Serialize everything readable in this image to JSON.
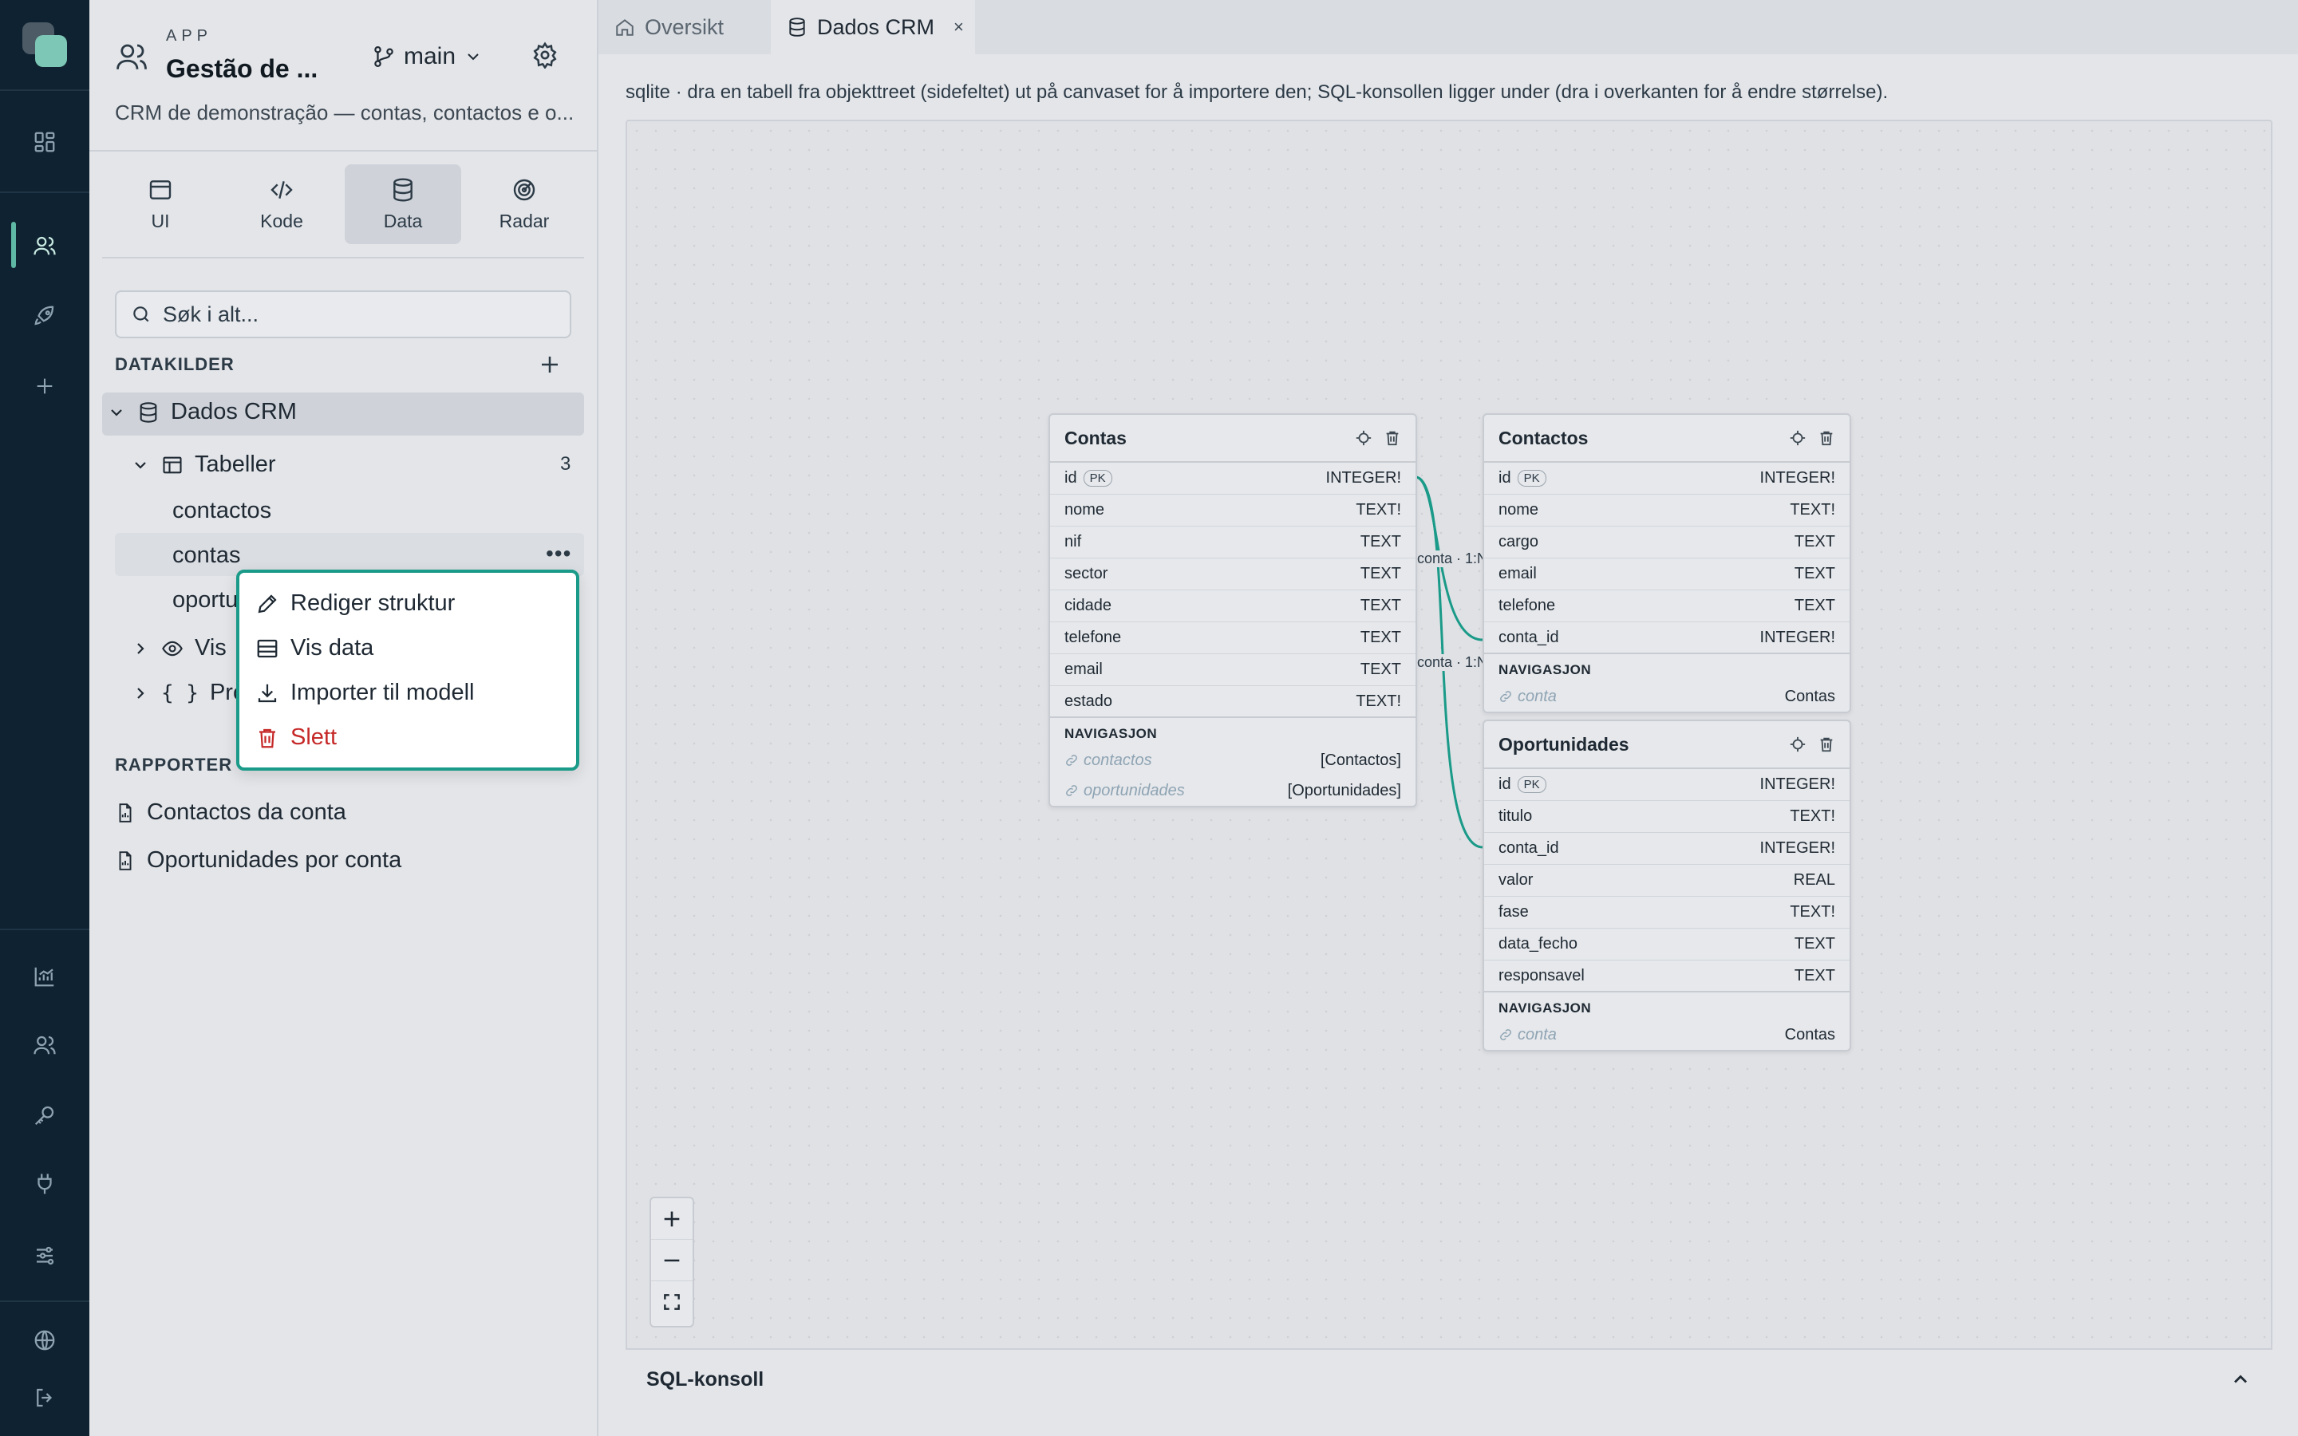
{
  "app": {
    "kicker": "APP",
    "title": "Gestão de ...",
    "branch": "main",
    "description": "CRM de demonstração — contas, contactos e o..."
  },
  "modes": [
    {
      "label": "UI",
      "icon": "window-icon"
    },
    {
      "label": "Kode",
      "icon": "code-icon"
    },
    {
      "label": "Data",
      "icon": "database-icon",
      "active": true
    },
    {
      "label": "Radar",
      "icon": "radar-icon"
    }
  ],
  "search": {
    "placeholder": "Søk i alt..."
  },
  "datasources": {
    "heading": "DATAKILDER",
    "source": "Dados CRM",
    "tables_label": "Tabeller",
    "tables_count": "3",
    "tables": [
      "contactos",
      "contas",
      "oportu"
    ],
    "views_label": "Vis",
    "procs_label": "Pro"
  },
  "context_menu": {
    "items": [
      {
        "label": "Rediger struktur",
        "icon": "pencil-icon"
      },
      {
        "label": "Vis data",
        "icon": "table-icon"
      },
      {
        "label": "Importer til modell",
        "icon": "download-icon"
      },
      {
        "label": "Slett",
        "icon": "trash-icon",
        "danger": true
      }
    ]
  },
  "reports": {
    "heading": "RAPPORTER",
    "items": [
      "Contactos da conta",
      "Oportunidades por conta"
    ]
  },
  "tabs": [
    {
      "label": "Oversikt",
      "icon": "home-icon"
    },
    {
      "label": "Dados CRM",
      "icon": "database-icon",
      "active": true,
      "close": "×"
    }
  ],
  "hint": "sqlite · dra en tabell fra objekttreet (sidefeltet) ut på canvaset for å importere den; SQL-konsollen ligger under (dra i overkanten for å endre størrelse).",
  "nav_heading": "NAVIGASJON",
  "pk_label": "PK",
  "er_tables": {
    "contas": {
      "name": "Contas",
      "columns": [
        {
          "name": "id",
          "type": "INTEGER!",
          "pk": true
        },
        {
          "name": "nome",
          "type": "TEXT!"
        },
        {
          "name": "nif",
          "type": "TEXT"
        },
        {
          "name": "sector",
          "type": "TEXT"
        },
        {
          "name": "cidade",
          "type": "TEXT"
        },
        {
          "name": "telefone",
          "type": "TEXT"
        },
        {
          "name": "email",
          "type": "TEXT"
        },
        {
          "name": "estado",
          "type": "TEXT!"
        }
      ],
      "navigation": [
        {
          "name": "contactos",
          "target": "[Contactos]"
        },
        {
          "name": "oportunidades",
          "target": "[Oportunidades]"
        }
      ]
    },
    "contactos": {
      "name": "Contactos",
      "columns": [
        {
          "name": "id",
          "type": "INTEGER!",
          "pk": true
        },
        {
          "name": "nome",
          "type": "TEXT!"
        },
        {
          "name": "cargo",
          "type": "TEXT"
        },
        {
          "name": "email",
          "type": "TEXT"
        },
        {
          "name": "telefone",
          "type": "TEXT"
        },
        {
          "name": "conta_id",
          "type": "INTEGER!"
        }
      ],
      "navigation": [
        {
          "name": "conta",
          "target": "Contas"
        }
      ]
    },
    "oportunidades": {
      "name": "Oportunidades",
      "columns": [
        {
          "name": "id",
          "type": "INTEGER!",
          "pk": true
        },
        {
          "name": "titulo",
          "type": "TEXT!"
        },
        {
          "name": "conta_id",
          "type": "INTEGER!"
        },
        {
          "name": "valor",
          "type": "REAL"
        },
        {
          "name": "fase",
          "type": "TEXT!"
        },
        {
          "name": "data_fecho",
          "type": "TEXT"
        },
        {
          "name": "responsavel",
          "type": "TEXT"
        }
      ],
      "navigation": [
        {
          "name": "conta",
          "target": "Contas"
        }
      ]
    }
  },
  "relations": [
    "conta · 1:N",
    "conta · 1:N"
  ],
  "console": {
    "title": "SQL-konsoll"
  },
  "colors": {
    "accent": "#1a9a88",
    "danger": "#c62828",
    "rail": "#0f2231"
  }
}
